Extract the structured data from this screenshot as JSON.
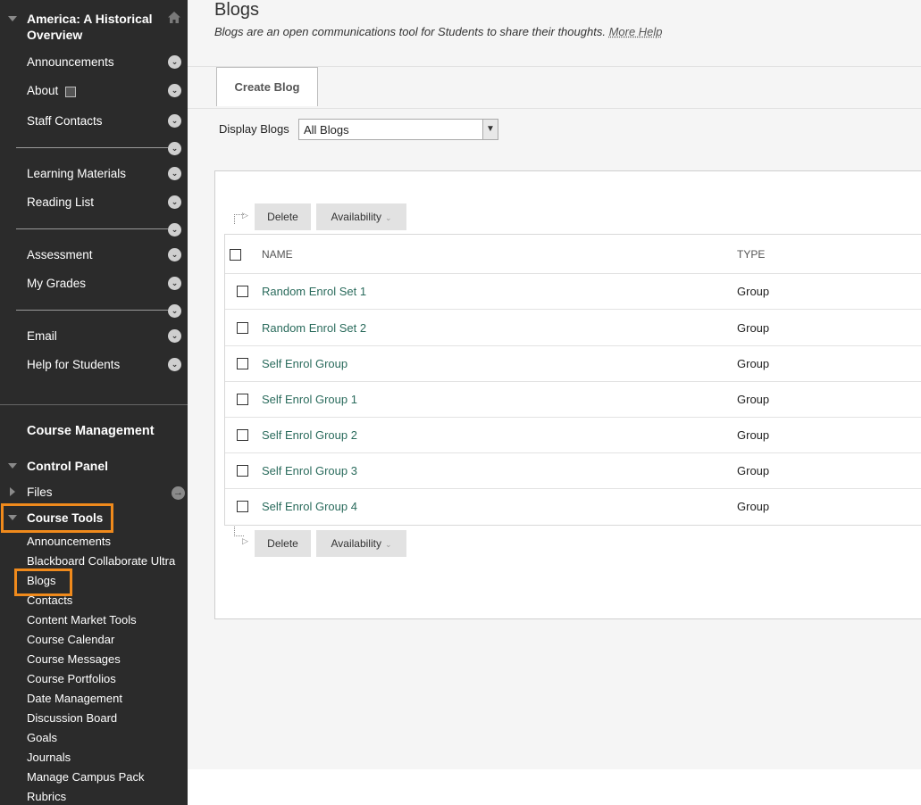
{
  "sidebar": {
    "course_title": "America: A Historical Overview",
    "menu_items": [
      {
        "label": "Announcements"
      },
      {
        "label": "About"
      },
      {
        "label": "Staff Contacts"
      },
      {
        "label": "Learning Materials"
      },
      {
        "label": "Reading List"
      },
      {
        "label": "Assessment"
      },
      {
        "label": "My Grades"
      },
      {
        "label": "Email"
      },
      {
        "label": "Help for Students"
      }
    ],
    "course_management": "Course Management",
    "control_panel": "Control Panel",
    "files": "Files",
    "course_tools": "Course Tools",
    "tools": [
      {
        "label": "Announcements"
      },
      {
        "label": "Blackboard Collaborate Ultra"
      },
      {
        "label": "Blogs"
      },
      {
        "label": "Contacts"
      },
      {
        "label": "Content Market Tools"
      },
      {
        "label": "Course Calendar"
      },
      {
        "label": "Course Messages"
      },
      {
        "label": "Course Portfolios"
      },
      {
        "label": "Date Management"
      },
      {
        "label": "Discussion Board"
      },
      {
        "label": "Goals"
      },
      {
        "label": "Journals"
      },
      {
        "label": "Manage Campus Pack"
      },
      {
        "label": "Rubrics"
      }
    ]
  },
  "main": {
    "title": "Blogs",
    "description": "Blogs are an open communications tool for Students to share their thoughts.",
    "more_help": "More Help",
    "create_button": "Create Blog",
    "display_label": "Display Blogs",
    "display_value": "All Blogs",
    "delete_label": "Delete",
    "availability_label": "Availability",
    "columns": {
      "name": "NAME",
      "type": "TYPE"
    },
    "rows": [
      {
        "name": "Random Enrol Set 1",
        "type": "Group"
      },
      {
        "name": "Random Enrol Set 2",
        "type": "Group"
      },
      {
        "name": "Self Enrol Group",
        "type": "Group"
      },
      {
        "name": "Self Enrol Group 1",
        "type": "Group"
      },
      {
        "name": "Self Enrol Group 2",
        "type": "Group"
      },
      {
        "name": "Self Enrol Group 3",
        "type": "Group"
      },
      {
        "name": "Self Enrol Group 4",
        "type": "Group"
      }
    ]
  },
  "colors": {
    "sidebar_bg": "#2b2b2b",
    "highlight": "#f08a1c",
    "link": "#2a6b5c"
  },
  "icons": [
    "home-icon",
    "caret-down-icon",
    "caret-right-icon",
    "chevron-down-icon",
    "arrow-right-icon",
    "calendar-icon",
    "select-arrow-icon",
    "checkbox-icon"
  ]
}
